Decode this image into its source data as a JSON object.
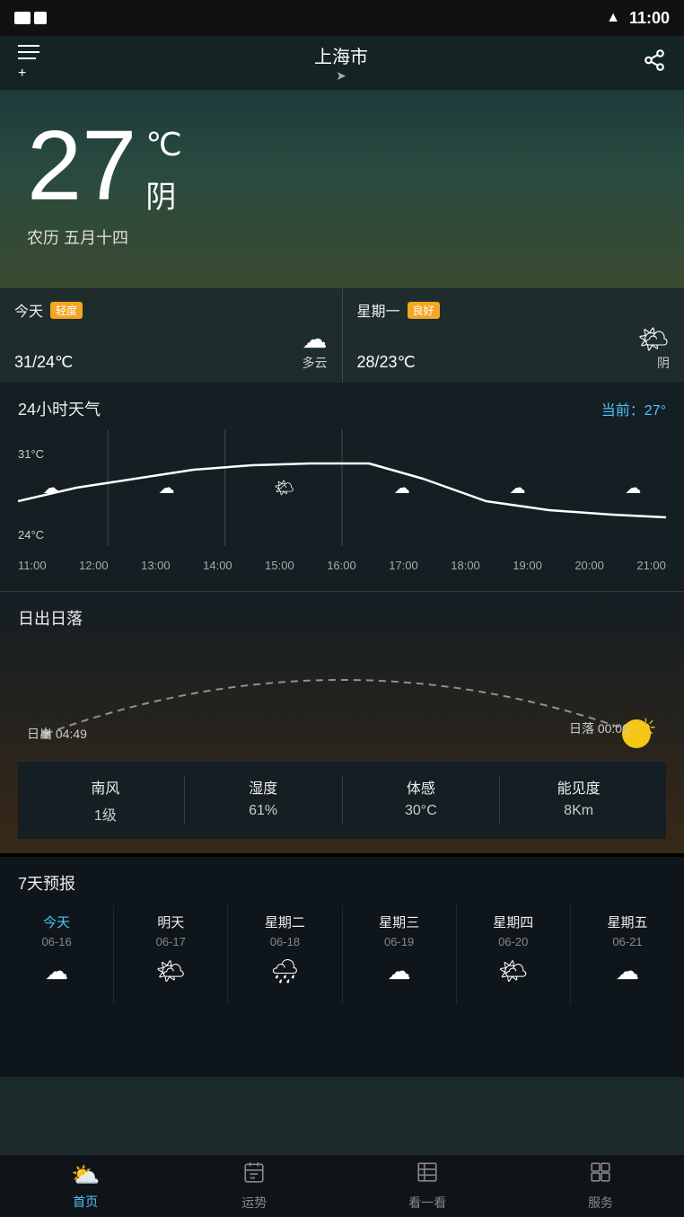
{
  "statusBar": {
    "time": "11:00"
  },
  "header": {
    "city": "上海市",
    "locationIcon": "➤",
    "menuIcon": "≡",
    "shareIcon": "⎋"
  },
  "mainWeather": {
    "temperature": "27",
    "unit": "℃",
    "description": "阴",
    "lunarDate": "农历 五月十四"
  },
  "dayStrip": [
    {
      "name": "今天",
      "badge": "轻度",
      "temp": "31/24℃",
      "condition": "多云",
      "icon": "☁"
    },
    {
      "name": "星期一",
      "badge": "良好",
      "temp": "28/23℃",
      "condition": "阴",
      "icon": "🌤"
    }
  ],
  "hourlyWeather": {
    "title": "24小时天气",
    "current": "当前：27°",
    "tempHigh": "31°C",
    "tempLow": "24°C",
    "hours": [
      "11:00",
      "12:00",
      "13:00",
      "14:00",
      "15:00",
      "16:00",
      "17:00",
      "18:00",
      "19:00",
      "20:00",
      "21:00"
    ],
    "icons": [
      "☁",
      "☁",
      "☁",
      "☁",
      "🌤",
      "🌤",
      "☁",
      "☁",
      "☁",
      "☁",
      "☁"
    ]
  },
  "sunriseSunset": {
    "title": "日出日落",
    "sunrise": "日出 04:49",
    "sunset": "日落 00:00"
  },
  "details": [
    {
      "label": "南风",
      "value": "1级"
    },
    {
      "label": "湿度",
      "value": "61%"
    },
    {
      "label": "体感",
      "value": "30°C"
    },
    {
      "label": "能见度",
      "value": "8Km"
    }
  ],
  "forecast": {
    "title": "7天预报",
    "days": [
      {
        "name": "今天",
        "isToday": true,
        "date": "06-16",
        "icon": "☁"
      },
      {
        "name": "明天",
        "isToday": false,
        "date": "06-17",
        "icon": "🌤"
      },
      {
        "name": "星期二",
        "isToday": false,
        "date": "06-18",
        "icon": "🌧"
      },
      {
        "name": "星期三",
        "isToday": false,
        "date": "06-19",
        "icon": "☁"
      },
      {
        "name": "星期四",
        "isToday": false,
        "date": "06-20",
        "icon": "🌤"
      },
      {
        "name": "星期五",
        "isToday": false,
        "date": "06-21",
        "icon": "☁"
      }
    ]
  },
  "bottomNav": [
    {
      "label": "首页",
      "icon": "🌤",
      "active": true
    },
    {
      "label": "运势",
      "icon": "📅",
      "active": false
    },
    {
      "label": "看一看",
      "icon": "📋",
      "active": false
    },
    {
      "label": "服务",
      "icon": "⊞",
      "active": false
    }
  ]
}
